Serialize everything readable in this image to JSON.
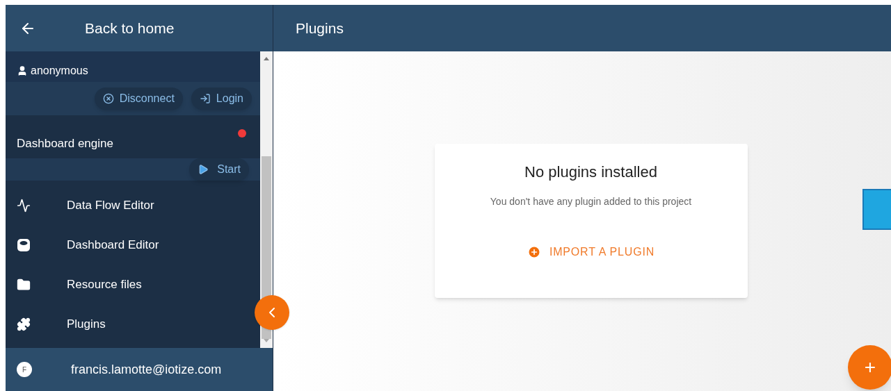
{
  "sidebar": {
    "back_label": "Back to home",
    "user": {
      "name": "anonymous",
      "buttons": [
        {
          "kind": "disconnect",
          "label": "Disconnect"
        },
        {
          "kind": "login",
          "label": "Login"
        }
      ]
    },
    "engine": {
      "title": "Dashboard engine",
      "color": "#f03a3a",
      "button": {
        "kind": "start",
        "label": "Start"
      }
    },
    "items": [
      {
        "kind": "flow",
        "label": "Data Flow Editor"
      },
      {
        "kind": "dashboard",
        "label": "Dashboard Editor"
      },
      {
        "kind": "folder",
        "label": "Resource files"
      },
      {
        "kind": "plugin",
        "label": "Plugins"
      }
    ],
    "account": {
      "initial": "F",
      "email": "francis.lamotte@iotize.com"
    }
  },
  "header": {
    "title": "Plugins"
  },
  "empty_state": {
    "title": "No plugins installed",
    "message": "You don't have any plugin added to this project",
    "action": "IMPORT A PLUGIN"
  },
  "fab": {
    "label": "+"
  }
}
